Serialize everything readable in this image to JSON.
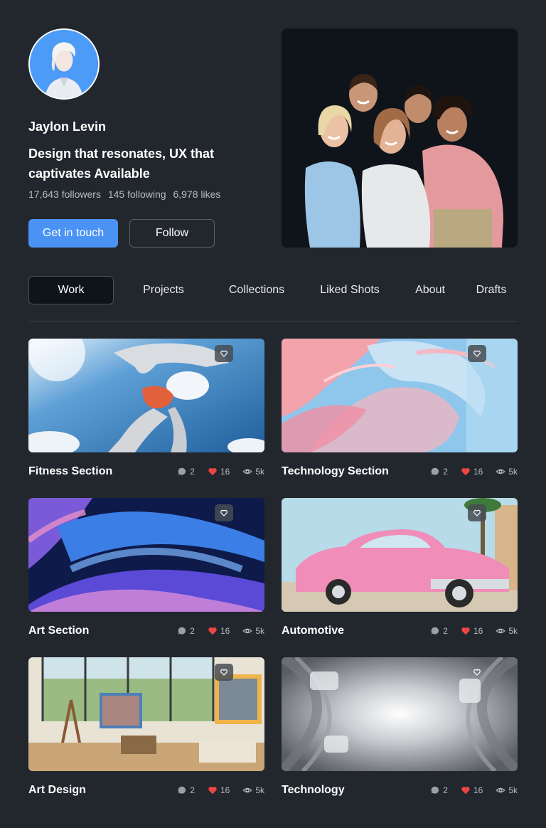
{
  "profile": {
    "name": "Jaylon Levin",
    "tagline": "Design that resonates, UX that captivates Available",
    "followers": "17,643 followers",
    "following": "145 following",
    "likes": "6,978 likes",
    "primary_button": "Get in touch",
    "secondary_button": "Follow"
  },
  "tabs": [
    {
      "label": "Work",
      "active": true
    },
    {
      "label": "Projects",
      "active": false
    },
    {
      "label": "Collections",
      "active": false
    },
    {
      "label": "Liked Shots",
      "active": false
    },
    {
      "label": "About",
      "active": false
    },
    {
      "label": "Drafts",
      "active": false
    }
  ],
  "shots": [
    {
      "title": "Fitness Section",
      "comments": "2",
      "likes": "16",
      "views": "5k"
    },
    {
      "title": "Technology Section",
      "comments": "2",
      "likes": "16",
      "views": "5k"
    },
    {
      "title": "Art Section",
      "comments": "2",
      "likes": "16",
      "views": "5k"
    },
    {
      "title": "Automotive",
      "comments": "2",
      "likes": "16",
      "views": "5k"
    },
    {
      "title": "Art Design",
      "comments": "2",
      "likes": "16",
      "views": "5k"
    },
    {
      "title": "Technology",
      "comments": "2",
      "likes": "16",
      "views": "5k"
    }
  ],
  "icons": {
    "comment": "comment-icon",
    "like": "heart-icon",
    "views": "eye-icon",
    "favorite": "heart-outline-icon"
  },
  "colors": {
    "background": "#22272d",
    "accent": "#4a93f5",
    "like": "#ef4444"
  }
}
